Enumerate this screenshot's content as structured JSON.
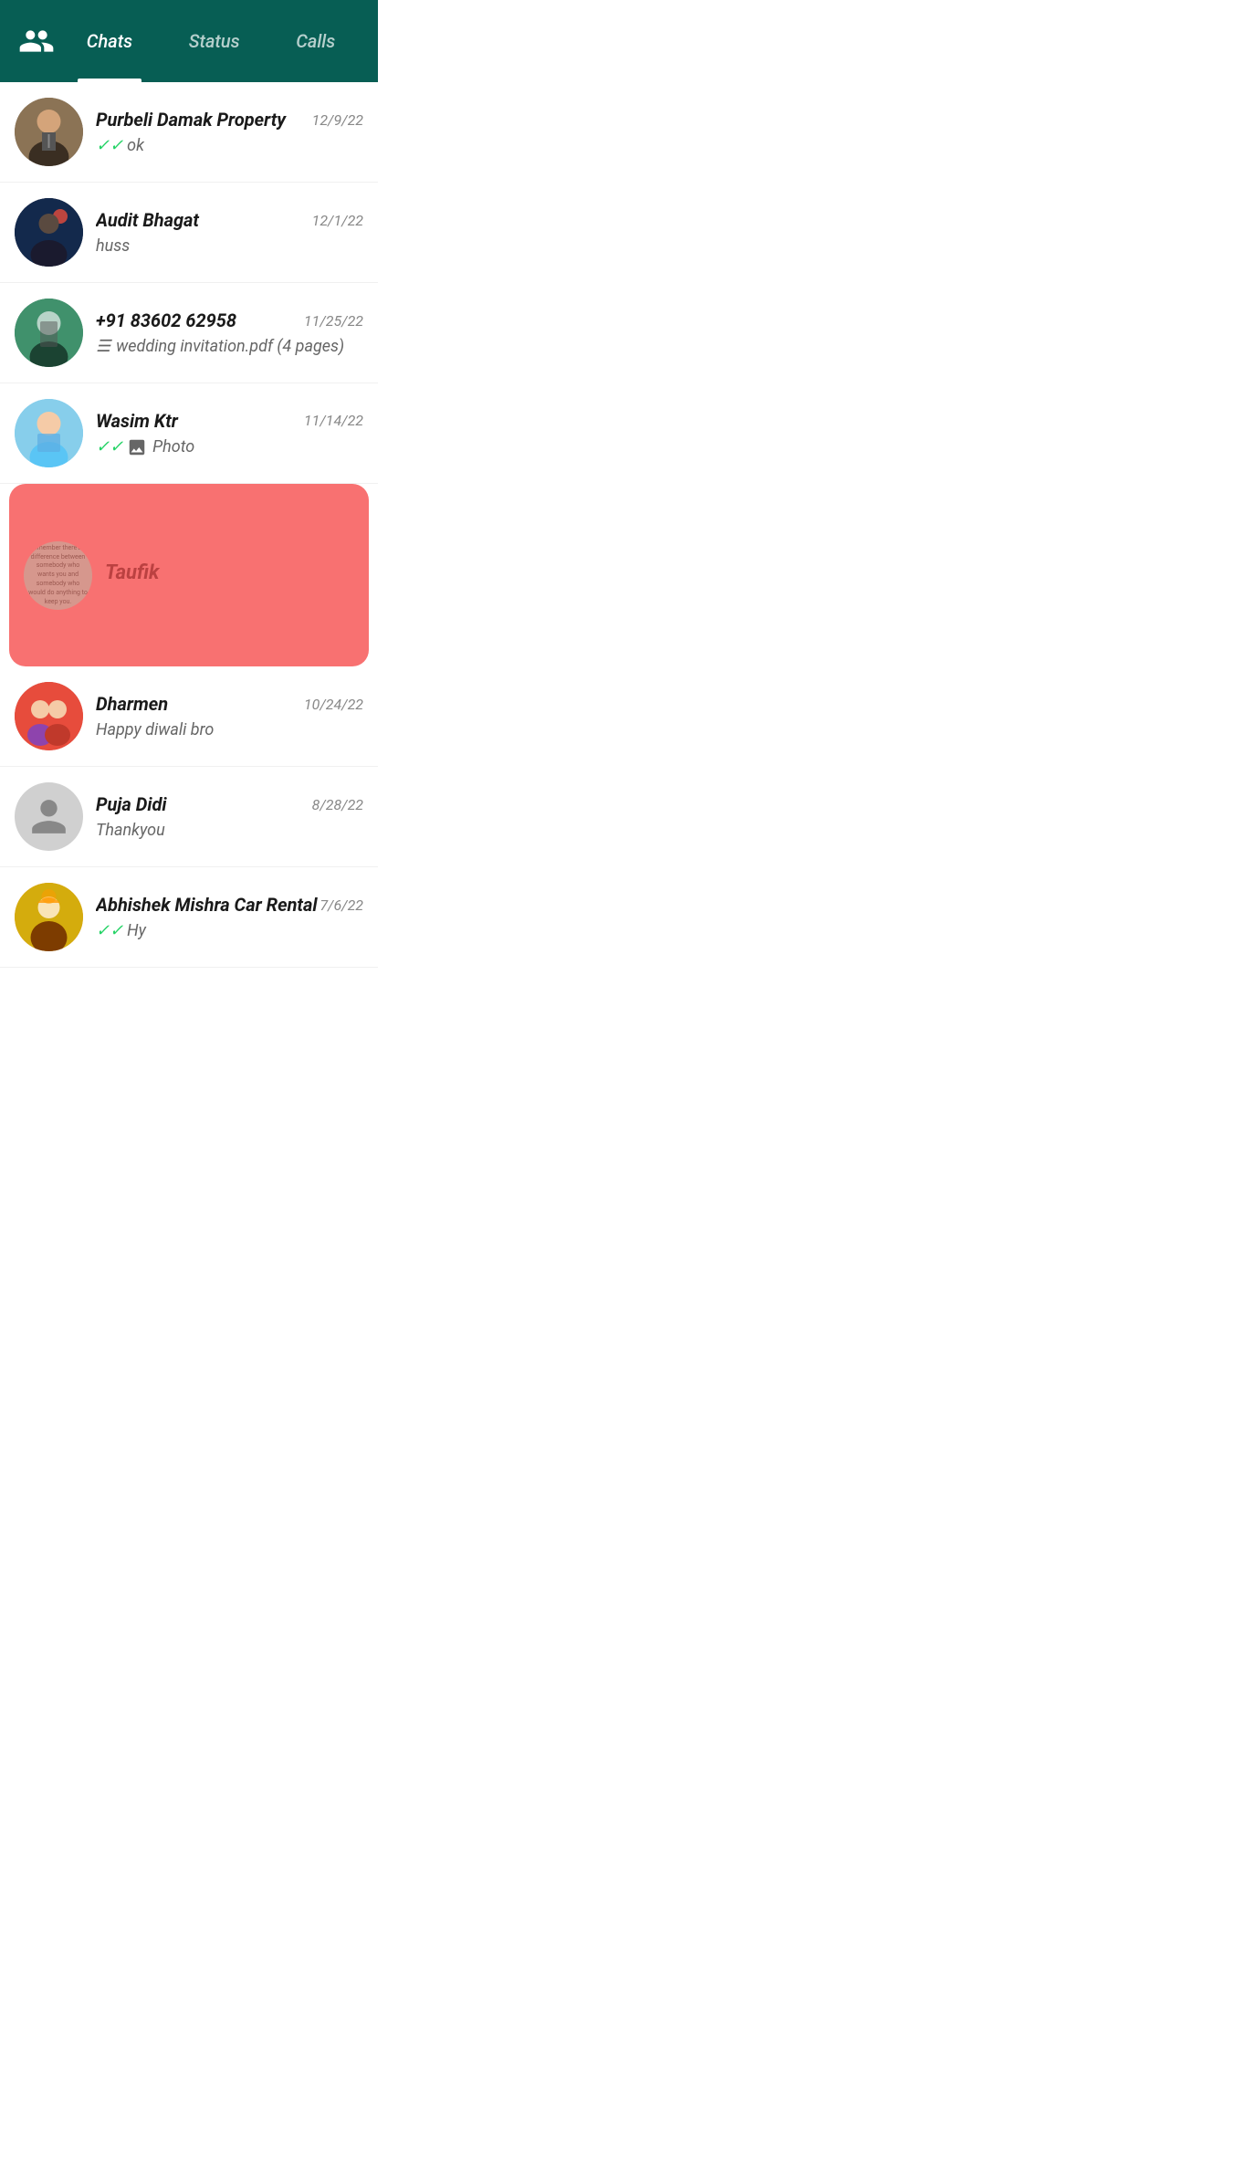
{
  "header": {
    "icon": "people-icon",
    "tabs": [
      {
        "id": "chats",
        "label": "Chats",
        "active": true
      },
      {
        "id": "status",
        "label": "Status",
        "active": false
      },
      {
        "id": "calls",
        "label": "Calls",
        "active": false
      }
    ]
  },
  "chats": [
    {
      "id": "purbeli",
      "name": "Purbeli Damak Property",
      "date": "12/9/22",
      "preview": "ok",
      "has_double_tick": true,
      "has_doc": false,
      "has_photo": false,
      "avatar_type": "purbeli",
      "highlighted": false
    },
    {
      "id": "audit",
      "name": "Audit Bhagat",
      "date": "12/1/22",
      "preview": "huss",
      "has_double_tick": false,
      "has_doc": false,
      "has_photo": false,
      "avatar_type": "audit",
      "highlighted": false
    },
    {
      "id": "phone",
      "name": "+91 83602 62958",
      "date": "11/25/22",
      "preview": "wedding invitation.pdf (4 pages)",
      "has_double_tick": false,
      "has_doc": true,
      "has_photo": false,
      "avatar_type": "phone",
      "highlighted": false
    },
    {
      "id": "wasim",
      "name": "Wasim Ktr",
      "date": "11/14/22",
      "preview": "Photo",
      "has_double_tick": true,
      "has_doc": false,
      "has_photo": true,
      "avatar_type": "wasim",
      "highlighted": false
    },
    {
      "id": "taufik",
      "name": "Taufik",
      "date": "",
      "preview": "",
      "has_double_tick": false,
      "has_doc": false,
      "has_photo": false,
      "avatar_type": "taufik",
      "highlighted": true,
      "quote_text": "Remember there's a difference between somebody who wants you and somebody who would do anything to keep you."
    },
    {
      "id": "dharmen",
      "name": "Dharmen",
      "date": "10/24/22",
      "preview": "Happy diwali bro",
      "has_double_tick": false,
      "has_doc": false,
      "has_photo": false,
      "avatar_type": "dharmen",
      "highlighted": false
    },
    {
      "id": "puja",
      "name": "Puja Didi",
      "date": "8/28/22",
      "preview": "Thankyou",
      "has_double_tick": false,
      "has_doc": false,
      "has_photo": false,
      "avatar_type": "placeholder",
      "highlighted": false
    },
    {
      "id": "abhishek",
      "name": "Abhishek Mishra Car Rental",
      "date": "7/6/22",
      "preview": "Hy",
      "has_double_tick": true,
      "has_doc": false,
      "has_photo": false,
      "avatar_type": "abhishek",
      "highlighted": false
    }
  ]
}
